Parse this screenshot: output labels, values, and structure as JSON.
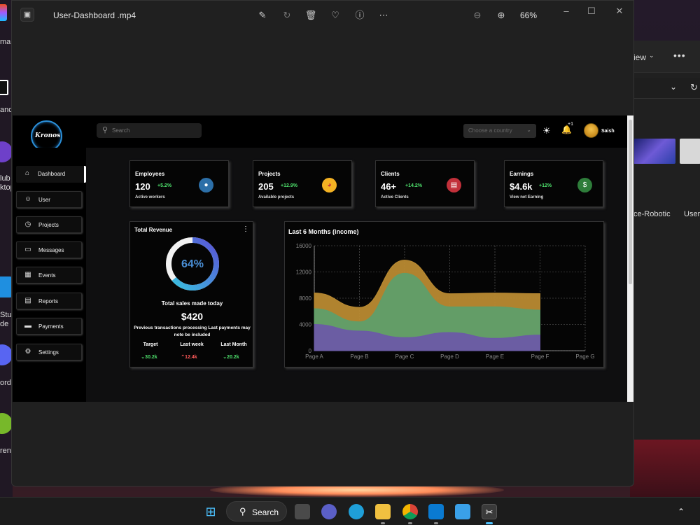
{
  "desktop": {
    "left_labels": [
      "ma",
      "andl",
      "lub",
      "ktop",
      "Stud",
      "de",
      "ord",
      "rent"
    ],
    "explorer": {
      "view_label": "iew",
      "items": [
        "ce-Robotic",
        "User-"
      ]
    }
  },
  "viewer": {
    "title": "User-Dashboard .mp4",
    "zoom": "66%",
    "tool_icons": [
      "edit-image-icon",
      "rotate-icon",
      "delete-icon",
      "heart-icon",
      "info-icon",
      "more-icon"
    ]
  },
  "dashboard": {
    "brand": "Kronos",
    "search_placeholder": "Search",
    "country_placeholder": "Choose a country",
    "bell_badge": "+1",
    "user_name": "Saish",
    "nav": [
      {
        "label": "Dashboard",
        "icon": "home-icon"
      },
      {
        "label": "User",
        "icon": "user-icon"
      },
      {
        "label": "Projects",
        "icon": "pie-icon"
      },
      {
        "label": "Messages",
        "icon": "message-icon"
      },
      {
        "label": "Events",
        "icon": "calendar-icon"
      },
      {
        "label": "Reports",
        "icon": "report-icon"
      },
      {
        "label": "Payments",
        "icon": "card-icon"
      },
      {
        "label": "Settings",
        "icon": "gear-icon"
      }
    ],
    "cards": [
      {
        "title": "Employees",
        "value": "120",
        "delta": "+5.2%",
        "sub": "Active workers",
        "icon": "person-icon",
        "color": "#2c6fa8"
      },
      {
        "title": "Projects",
        "value": "205",
        "delta": "+12.9%",
        "sub": "Available projects",
        "icon": "pie-chart-icon",
        "color": "#f4b223"
      },
      {
        "title": "Clients",
        "value": "46+",
        "delta": "+14.2%",
        "sub": "Active Clients",
        "icon": "briefcase-icon",
        "color": "#c2303a"
      },
      {
        "title": "Earnings",
        "value": "$4.6k",
        "delta": "+12%",
        "sub": "View net Earning",
        "icon": "dollar-icon",
        "color": "#2e7d3a"
      }
    ],
    "revenue": {
      "title": "Total Revenue",
      "percent": 64,
      "percent_label": "64%",
      "sales_label": "Total sales made today",
      "amount": "$420",
      "note": "Previous transactions processing Last payments may note be included",
      "stats": [
        {
          "label": "Target",
          "value": "30.2k",
          "trend": "down",
          "color": "#4ee06c"
        },
        {
          "label": "Last week",
          "value": "12.4k",
          "trend": "up",
          "color": "#ff5a5a"
        },
        {
          "label": "Last Month",
          "value": "20.2k",
          "trend": "down",
          "color": "#4ee06c"
        }
      ]
    },
    "chart_data": {
      "type": "area",
      "title": "Last 6 Months (income)",
      "categories": [
        "Page A",
        "Page B",
        "Page C",
        "Page D",
        "Page E",
        "Page F",
        "Page G"
      ],
      "ylim": [
        0,
        16000
      ],
      "yticks": [
        0,
        4000,
        8000,
        12000,
        16000
      ],
      "grid": true,
      "stacked": true,
      "series": [
        {
          "values": [
            4000,
            3000,
            2000,
            2780,
            1890,
            2390
          ],
          "color": "#6b5aa6"
        },
        {
          "values": [
            2400,
            1400,
            9800,
            3900,
            4800,
            3800
          ],
          "color": "#5f9e6a"
        },
        {
          "values": [
            2400,
            2200,
            2000,
            2000,
            2100,
            2500
          ],
          "color": "#b98a32"
        }
      ]
    }
  },
  "taskbar": {
    "search_label": "Search",
    "apps": [
      "windows-start-icon",
      "task-view-icon",
      "chat-icon",
      "edge-icon",
      "file-explorer-icon",
      "chrome-icon",
      "vscode-icon",
      "photos-icon",
      "snipping-tool-icon"
    ]
  }
}
